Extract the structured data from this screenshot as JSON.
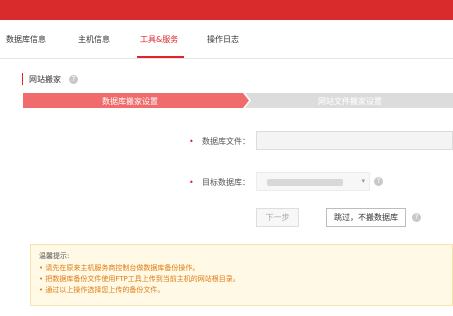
{
  "tabs": [
    {
      "label": "数据库信息",
      "active": false
    },
    {
      "label": "主机信息",
      "active": false
    },
    {
      "label": "工具&服务",
      "active": true
    },
    {
      "label": "操作日志",
      "active": false
    }
  ],
  "section": {
    "title": "网站搬家",
    "help_icon": "question-circle-icon"
  },
  "steps": [
    {
      "label": "数据库搬家设置",
      "state": "active"
    },
    {
      "label": "网站文件搬家设置",
      "state": "pending"
    }
  ],
  "form": {
    "db_file_label": "数据库文件：",
    "db_file_value": "",
    "target_db_label": "目标数据库：",
    "target_db_value": ""
  },
  "buttons": {
    "next": "下一步",
    "skip": "跳过，不搬数据库"
  },
  "tips": {
    "title": "温馨提示:",
    "items": [
      "请先在原来主机服务商控制台做数据库备份操作。",
      "把数据库备份文件使用FTP工具上传到当前主机的网站根目录。",
      "通过以上操作选择您上传的备份文件。"
    ]
  },
  "colors": {
    "brand": "#d92b2b",
    "accent": "#e0242b",
    "step_active": "#f06b6b",
    "step_pending": "#dcdcdc",
    "tip_text": "#e07b12"
  }
}
